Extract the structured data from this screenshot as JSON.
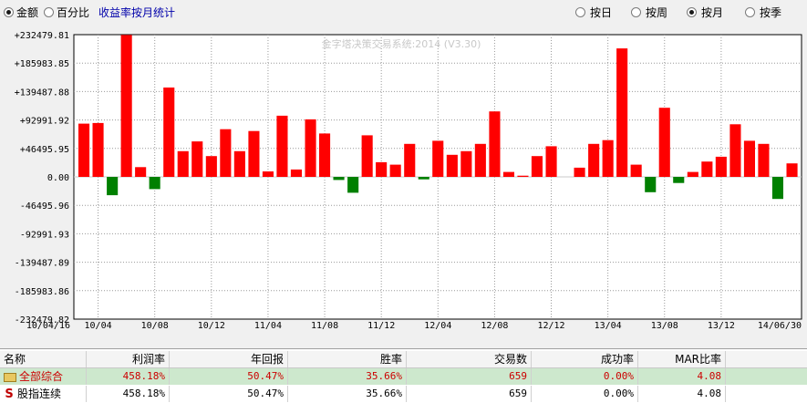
{
  "toolbar": {
    "mode_amount": "金额",
    "mode_percent": "百分比",
    "chart_title": "收益率按月统计",
    "period_day": "按日",
    "period_week": "按周",
    "period_month": "按月",
    "period_quarter": "按季",
    "selected_mode": "mode_amount",
    "selected_period": "period_month"
  },
  "chart_data": {
    "type": "bar",
    "watermark": "金字塔决策交易系统:2014 (V3.30)",
    "ylim": [
      -232479.82,
      232479.81
    ],
    "y_ticks": [
      232479.81,
      185983.85,
      139487.88,
      92991.92,
      46495.95,
      0,
      -46495.96,
      -92991.93,
      -139487.89,
      -185983.86,
      -232479.82
    ],
    "y_tick_labels": [
      "+232479.81",
      "+185983.85",
      "+139487.88",
      "+92991.92",
      "+46495.95",
      "0.00",
      "-46495.96",
      "-92991.93",
      "-139487.89",
      "-185983.86",
      "-232479.82"
    ],
    "x_tick_labels": [
      {
        "label": "10/04/16",
        "bar": 0
      },
      {
        "label": "10/04",
        "bar": 1
      },
      {
        "label": "10/08",
        "bar": 5
      },
      {
        "label": "10/12",
        "bar": 9
      },
      {
        "label": "11/04",
        "bar": 13
      },
      {
        "label": "11/08",
        "bar": 17
      },
      {
        "label": "11/12",
        "bar": 21
      },
      {
        "label": "12/04",
        "bar": 25
      },
      {
        "label": "12/08",
        "bar": 29
      },
      {
        "label": "12/12",
        "bar": 33
      },
      {
        "label": "13/04",
        "bar": 37
      },
      {
        "label": "13/08",
        "bar": 41
      },
      {
        "label": "13/12",
        "bar": 45
      },
      {
        "label": "14/06/30",
        "bar": 50
      }
    ],
    "values": [
      87000,
      88000,
      -30000,
      232000,
      16000,
      -20000,
      146000,
      42000,
      58000,
      34000,
      78000,
      42000,
      75000,
      9000,
      100000,
      12000,
      94000,
      71000,
      -5000,
      -26000,
      68000,
      24000,
      20000,
      54000,
      -4000,
      59000,
      36000,
      42000,
      54000,
      107000,
      8000,
      2000,
      34000,
      50000,
      0,
      15000,
      54000,
      60000,
      210000,
      20000,
      -25000,
      113000,
      -10000,
      8000,
      25000,
      33000,
      86000,
      59000,
      54000,
      -36000,
      22000
    ],
    "positive_color": "#ff0000",
    "negative_color": "#008000",
    "grid": true
  },
  "table": {
    "headers": [
      "名称",
      "利润率",
      "年回报",
      "胜率",
      "交易数",
      "成功率",
      "MAR比率"
    ],
    "rows": [
      {
        "name": "全部综合",
        "icon": "folder-icon",
        "values": [
          "458.18%",
          "50.47%",
          "35.66%",
          "659",
          "0.00%",
          "4.08"
        ]
      },
      {
        "name": "股指连续",
        "icon": "s-icon",
        "values": [
          "458.18%",
          "50.47%",
          "35.66%",
          "659",
          "0.00%",
          "4.08"
        ]
      }
    ]
  }
}
